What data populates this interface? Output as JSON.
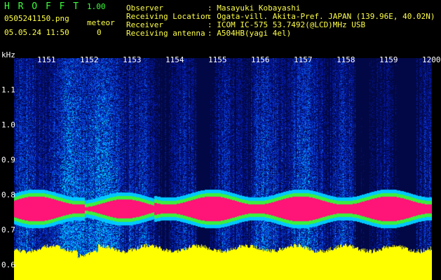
{
  "header": {
    "app_title": "H R O F F T",
    "version": "1.00",
    "filename": "0505241150.png",
    "datetime": "05.05.24 11:50",
    "counter_label": "meteor",
    "counter_value": "0"
  },
  "station": {
    "observer_label": "Observer",
    "observer_value": ": Masayuki Kobayashi",
    "location_label": "Receiving Location",
    "location_value": ": Ogata-vill. Akita-Pref. JAPAN (139.96E, 40.02N)",
    "receiver_label": "Receiver",
    "receiver_value": ": ICOM IC-575 53.7492(@LCD)MHz USB",
    "antenna_label": "Receiving antenna",
    "antenna_value": ": A504HB(yagi 4el)"
  },
  "axes": {
    "y_unit": "kHz",
    "y_ticks": [
      "1.1",
      "1.0",
      "0.9",
      "0.8",
      "0.7",
      "0.6"
    ],
    "x_ticks": [
      "1151",
      "1152",
      "1153",
      "1154",
      "1155",
      "1156",
      "1157",
      "1158",
      "1159",
      "1200"
    ]
  },
  "colors": {
    "signal": "#ff1a78",
    "baseline": "#ffff00",
    "background_noise": "#0a1a8a",
    "header_green": "#3cff3c",
    "header_yellow": "#ffff4a"
  }
}
